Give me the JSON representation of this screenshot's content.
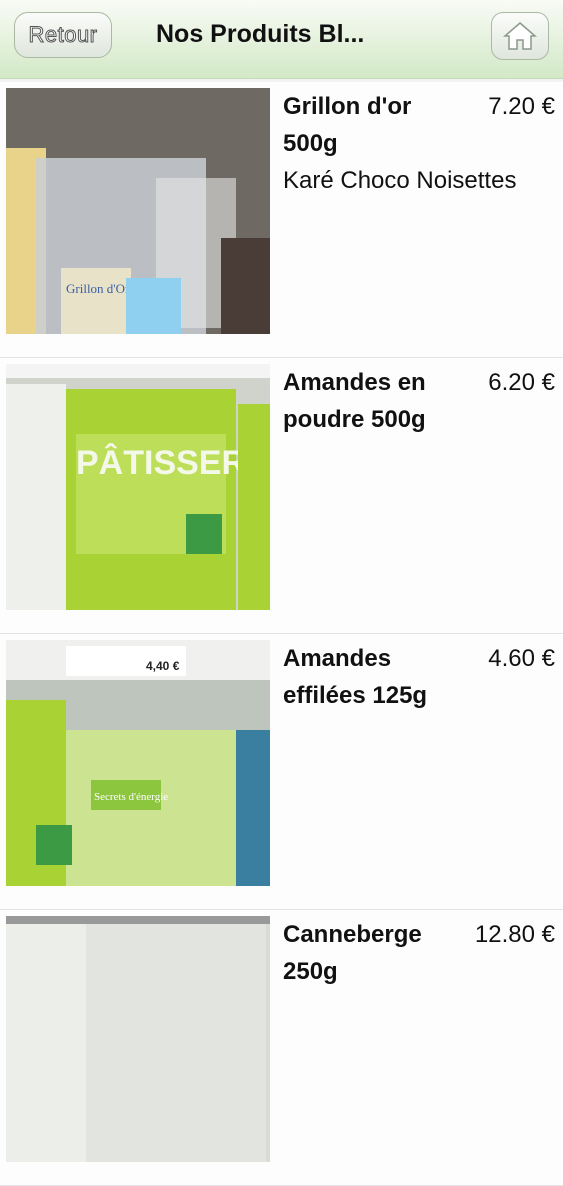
{
  "header": {
    "back_label": "Retour",
    "title": "Nos Produits Bl...",
    "home_icon": "home-icon"
  },
  "products": [
    {
      "name": "Grillon d'or 500g",
      "price": "7.20 €",
      "description": "Karé Choco Noisettes",
      "image_label": "Grillon d'Or"
    },
    {
      "name": "Amandes en poudre 500g",
      "price": "6.20 €",
      "description": "",
      "image_label": "PÂTISSERIES"
    },
    {
      "name": "Amandes effilées 125g",
      "price": "4.60 €",
      "description": "",
      "image_label": "Secrets d'énergie",
      "shelf_price": "4,40 €"
    },
    {
      "name": "Canneberge 250g",
      "price": "12.80 €",
      "description": ""
    }
  ],
  "colors": {
    "accent_green": "#8cc63e",
    "header_green": "#d2e9c6"
  }
}
